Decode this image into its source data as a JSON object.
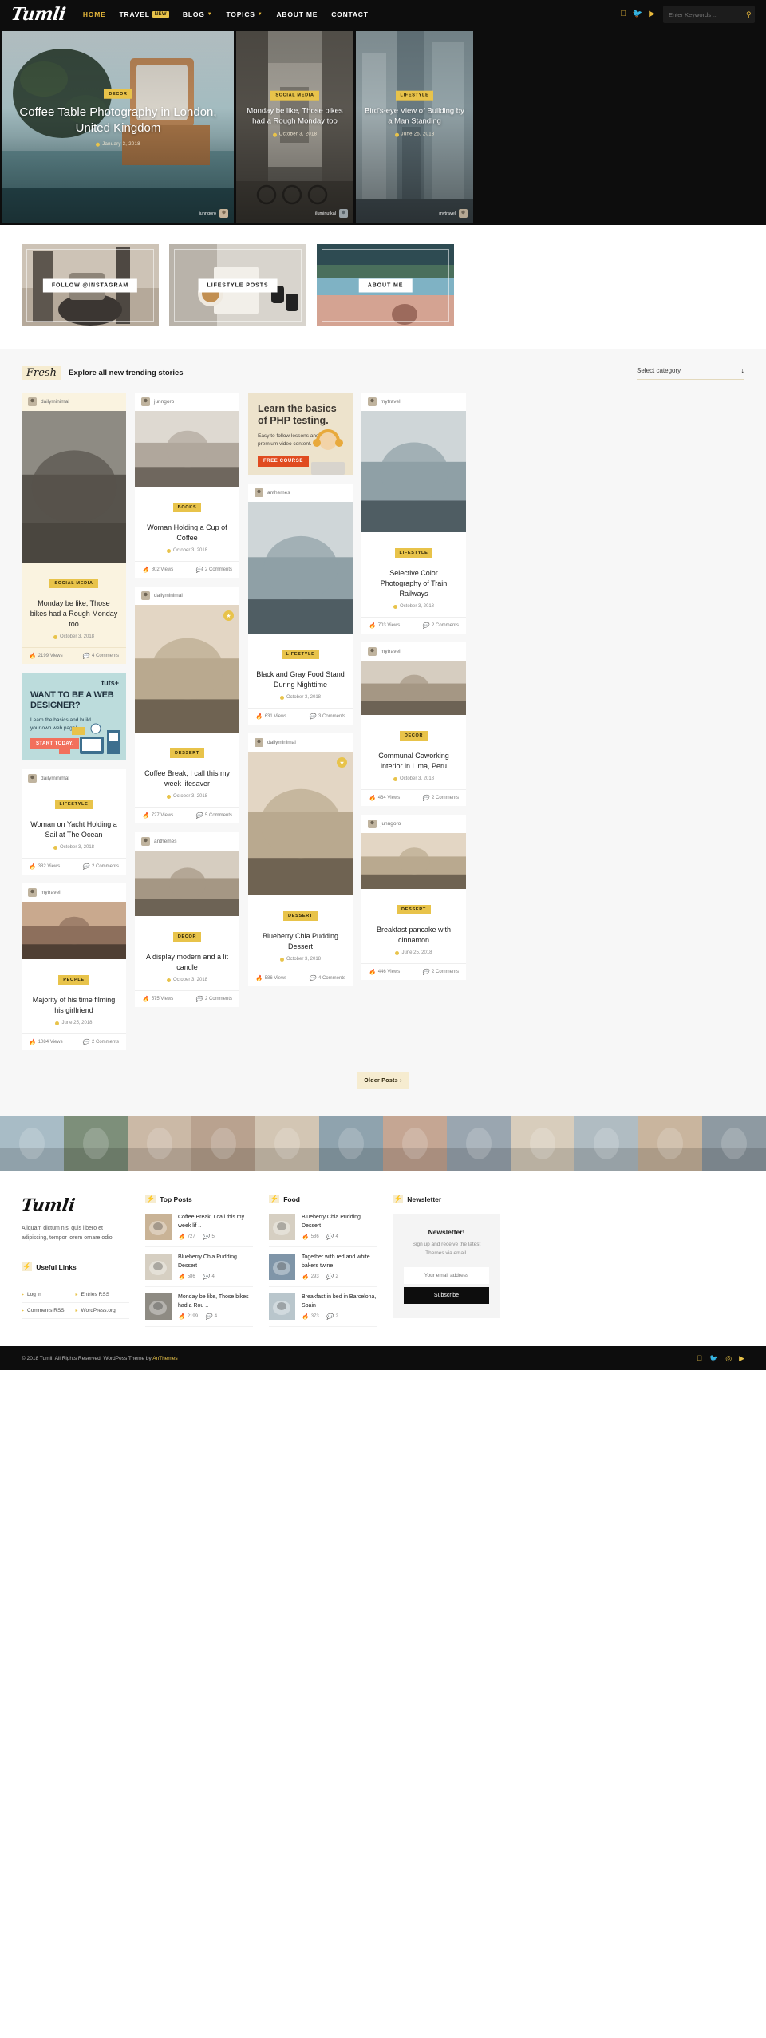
{
  "site": {
    "logo": "Tumli",
    "search_placeholder": "Enter Keywords ...",
    "accent": "#e8c34a",
    "dark": "#0d0d0d"
  },
  "nav": {
    "items": [
      {
        "label": "HOME",
        "active": true,
        "badge": "",
        "caret": false
      },
      {
        "label": "TRAVEL",
        "active": false,
        "badge": "NEW",
        "caret": false
      },
      {
        "label": "BLOG",
        "active": false,
        "badge": "",
        "caret": true
      },
      {
        "label": "TOPICS",
        "active": false,
        "badge": "",
        "caret": true
      },
      {
        "label": "ABOUT ME",
        "active": false,
        "badge": "",
        "caret": false
      },
      {
        "label": "CONTACT",
        "active": false,
        "badge": "",
        "caret": false
      }
    ],
    "social": [
      "facebook-icon",
      "twitter-icon",
      "youtube-icon"
    ]
  },
  "hero": [
    {
      "category": "DECOR",
      "title": "Coffee Table Photography in London, United Kingdom",
      "date": "January 3, 2018",
      "author": "junngoro"
    },
    {
      "category": "SOCIAL MEDIA",
      "title": "Monday be like, Those bikes had a Rough Monday too",
      "date": "October 3, 2018",
      "author": "iluminutkal"
    },
    {
      "category": "LIFESTYLE",
      "title": "Bird's-eye View of Building by a Man Standing",
      "date": "June 25, 2018",
      "author": "mytravel"
    }
  ],
  "promos": [
    {
      "label": "FOLLOW @INSTAGRAM"
    },
    {
      "label": "LIFESTYLE POSTS"
    },
    {
      "label": "ABOUT ME"
    }
  ],
  "fresh": {
    "tag": "Fresh",
    "subtitle": "Explore all new trending stories",
    "category_select": "Select category",
    "older_posts": "Older Posts  ›"
  },
  "ads": {
    "php": {
      "heading": "Learn the basics of PHP testing.",
      "body": "Easy to follow lessons and premium video content.",
      "cta": "FREE COURSE"
    },
    "tuts": {
      "brand": "tuts+",
      "heading": "WANT TO BE A WEB DESIGNER?",
      "body": "Learn the basics and build your own web page!",
      "cta": "START TODAY."
    }
  },
  "posts": {
    "col1": [
      {
        "author": "dailyminimal",
        "category": "SOCIAL MEDIA",
        "title": "Monday be like, Those bikes had a Rough Monday too",
        "date": "October 3, 2018",
        "views": "2199 Views",
        "comments": "4 Comments",
        "thumb_h": 190,
        "cream": true,
        "bookmark": false
      },
      {
        "author": "dailyminimal",
        "category": "LIFESTYLE",
        "title": "Woman on Yacht Holding a Sail at The Ocean",
        "date": "October 3, 2018",
        "views": "382 Views",
        "comments": "2 Comments",
        "thumb_h": 0,
        "cream": false,
        "bookmark": false
      },
      {
        "author": "mytravel",
        "category": "PEOPLE",
        "title": "Majority of his time filming his girlfriend",
        "date": "June 25, 2018",
        "views": "1084 Views",
        "comments": "2 Comments",
        "thumb_h": 72,
        "cream": false,
        "bookmark": false
      }
    ],
    "col2": [
      {
        "author": "junngoro",
        "category": "BOOKS",
        "title": "Woman Holding a Cup of Coffee",
        "date": "October 3, 2018",
        "views": "802 Views",
        "comments": "2 Comments",
        "thumb_h": 95,
        "cream": false,
        "bookmark": false
      },
      {
        "author": "dailyminimal",
        "category": "DESSERT",
        "title": "Coffee Break, I call this my week lifesaver",
        "date": "October 3, 2018",
        "views": "727 Views",
        "comments": "5 Comments",
        "thumb_h": 160,
        "cream": false,
        "bookmark": true
      },
      {
        "author": "anthemes",
        "category": "DECOR",
        "title": "A display modern and a lit candle",
        "date": "October 3, 2018",
        "views": "575 Views",
        "comments": "2 Comments",
        "thumb_h": 82,
        "cream": false,
        "bookmark": false
      }
    ],
    "col3": [
      {
        "author": "anthemes",
        "category": "LIFESTYLE",
        "title": "Black and Gray Food Stand During Nighttime",
        "date": "October 3, 2018",
        "views": "631 Views",
        "comments": "3 Comments",
        "thumb_h": 165,
        "cream": false,
        "bookmark": false
      },
      {
        "author": "dailyminimal",
        "category": "DESSERT",
        "title": "Blueberry Chia Pudding Dessert",
        "date": "October 3, 2018",
        "views": "586 Views",
        "comments": "4 Comments",
        "thumb_h": 180,
        "cream": false,
        "bookmark": true
      }
    ],
    "col4": [
      {
        "author": "mytravel",
        "category": "LIFESTYLE",
        "title": "Selective Color Photography of Train Railways",
        "date": "October 3, 2018",
        "views": "703 Views",
        "comments": "2 Comments",
        "thumb_h": 152,
        "cream": false,
        "bookmark": false
      },
      {
        "author": "mytravel",
        "category": "DECOR",
        "title": "Communal Coworking interior in Lima, Peru",
        "date": "October 3, 2018",
        "views": "464 Views",
        "comments": "2 Comments",
        "thumb_h": 68,
        "cream": false,
        "bookmark": false
      },
      {
        "author": "junngoro",
        "category": "DESSERT",
        "title": "Breakfast pancake with cinnamon",
        "date": "June 25, 2018",
        "views": "446 Views",
        "comments": "2 Comments",
        "thumb_h": 70,
        "cream": false,
        "bookmark": false
      }
    ]
  },
  "footer": {
    "logo": "Tumli",
    "description": "Aliquam dictum nisl quis libero et adipiscing, tempor lorem ornare odio.",
    "useful_links_title": "Useful Links",
    "useful_links": [
      "Log in",
      "Entries RSS",
      "Comments RSS",
      "WordPress.org"
    ],
    "top_posts_title": "Top Posts",
    "top_posts": [
      {
        "title": "Coffee Break, I call this my week lif ..",
        "views": "727",
        "comments": "5"
      },
      {
        "title": "Blueberry Chia Pudding Dessert",
        "views": "586",
        "comments": "4"
      },
      {
        "title": "Monday be like, Those bikes had a Rou ..",
        "views": "2199",
        "comments": "4"
      }
    ],
    "food_title": "Food",
    "food_posts": [
      {
        "title": "Blueberry Chia Pudding Dessert",
        "views": "586",
        "comments": "4"
      },
      {
        "title": "Together with red and white bakers twine",
        "views": "293",
        "comments": "2"
      },
      {
        "title": "Breakfast in bed in Barcelona, Spain",
        "views": "373",
        "comments": "2"
      }
    ],
    "newsletter_title": "Newsletter",
    "newsletter": {
      "heading": "Newsletter!",
      "body": "Sign up and receive the latest Themes via email.",
      "placeholder": "Your email address",
      "button": "Subscribe"
    },
    "copyright_pre": "© 2018 Tumli. All Rights Reserved. WordPess Theme by ",
    "copyright_brand": "AnThemes",
    "copyright_social": [
      "facebook-icon",
      "twitter-icon",
      "instagram-icon",
      "youtube-icon"
    ]
  }
}
